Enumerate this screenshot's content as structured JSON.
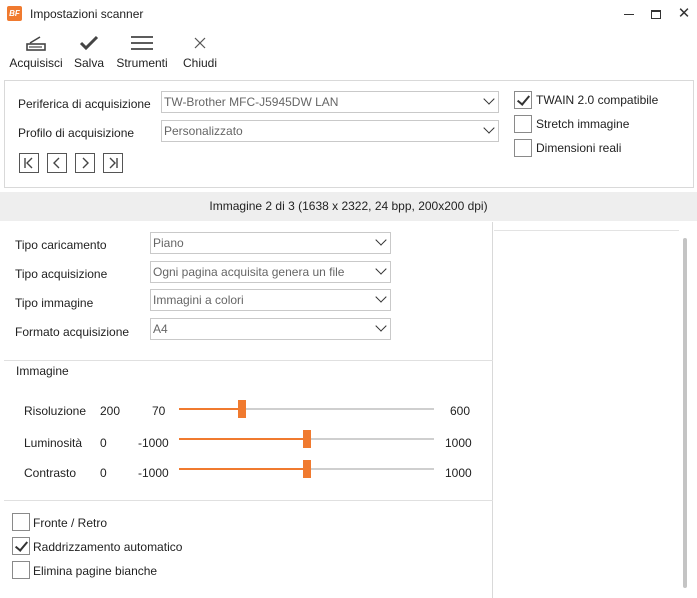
{
  "window": {
    "logo_text": "BF",
    "title": "Impostazioni scanner",
    "close_glyph": "✕"
  },
  "toolbar": {
    "acquisisci": "Acquisisci",
    "salva": "Salva",
    "strumenti": "Strumenti",
    "chiudi": "Chiudi"
  },
  "device": {
    "periferica_label": "Periferica di acquisizione",
    "periferica_value": "TW-Brother MFC-J5945DW LAN",
    "profilo_label": "Profilo di acquisizione",
    "profilo_value": "Personalizzato"
  },
  "options_top": {
    "twain": {
      "label": "TWAIN 2.0 compatibile",
      "checked": true
    },
    "stretch": {
      "label": "Stretch immagine",
      "checked": false
    },
    "dimensioni": {
      "label": "Dimensioni reali",
      "checked": false
    }
  },
  "status": {
    "text": "Immagine 2 di 3 (1638 x 2322, 24 bpp, 200x200 dpi)"
  },
  "settings": {
    "caricamento_label": "Tipo caricamento",
    "caricamento_value": "Piano",
    "acquisizione_label": "Tipo acquisizione",
    "acquisizione_value": "Ogni pagina acquisita genera un file",
    "immagine_label": "Tipo immagine",
    "immagine_value": "Immagini a colori",
    "formato_label": "Formato acquisizione",
    "formato_value": "A4"
  },
  "image_section": {
    "title": "Immagine",
    "sliders": [
      {
        "label": "Risoluzione",
        "value": "200",
        "min": "70",
        "max": "600",
        "numeric_value": 200,
        "numeric_min": 70,
        "numeric_max": 600
      },
      {
        "label": "Luminosità",
        "value": "0",
        "min": "-1000",
        "max": "1000",
        "numeric_value": 0,
        "numeric_min": -1000,
        "numeric_max": 1000
      },
      {
        "label": "Contrasto",
        "value": "0",
        "min": "-1000",
        "max": "1000",
        "numeric_value": 0,
        "numeric_min": -1000,
        "numeric_max": 1000
      }
    ]
  },
  "options_bottom": {
    "fronte": {
      "label": "Fronte / Retro",
      "checked": false
    },
    "raddrizzamento": {
      "label": "Raddrizzamento automatico",
      "checked": true
    },
    "elimina": {
      "label": "Elimina pagine bianche",
      "checked": false
    }
  },
  "colors": {
    "accent": "#f07a2f"
  }
}
